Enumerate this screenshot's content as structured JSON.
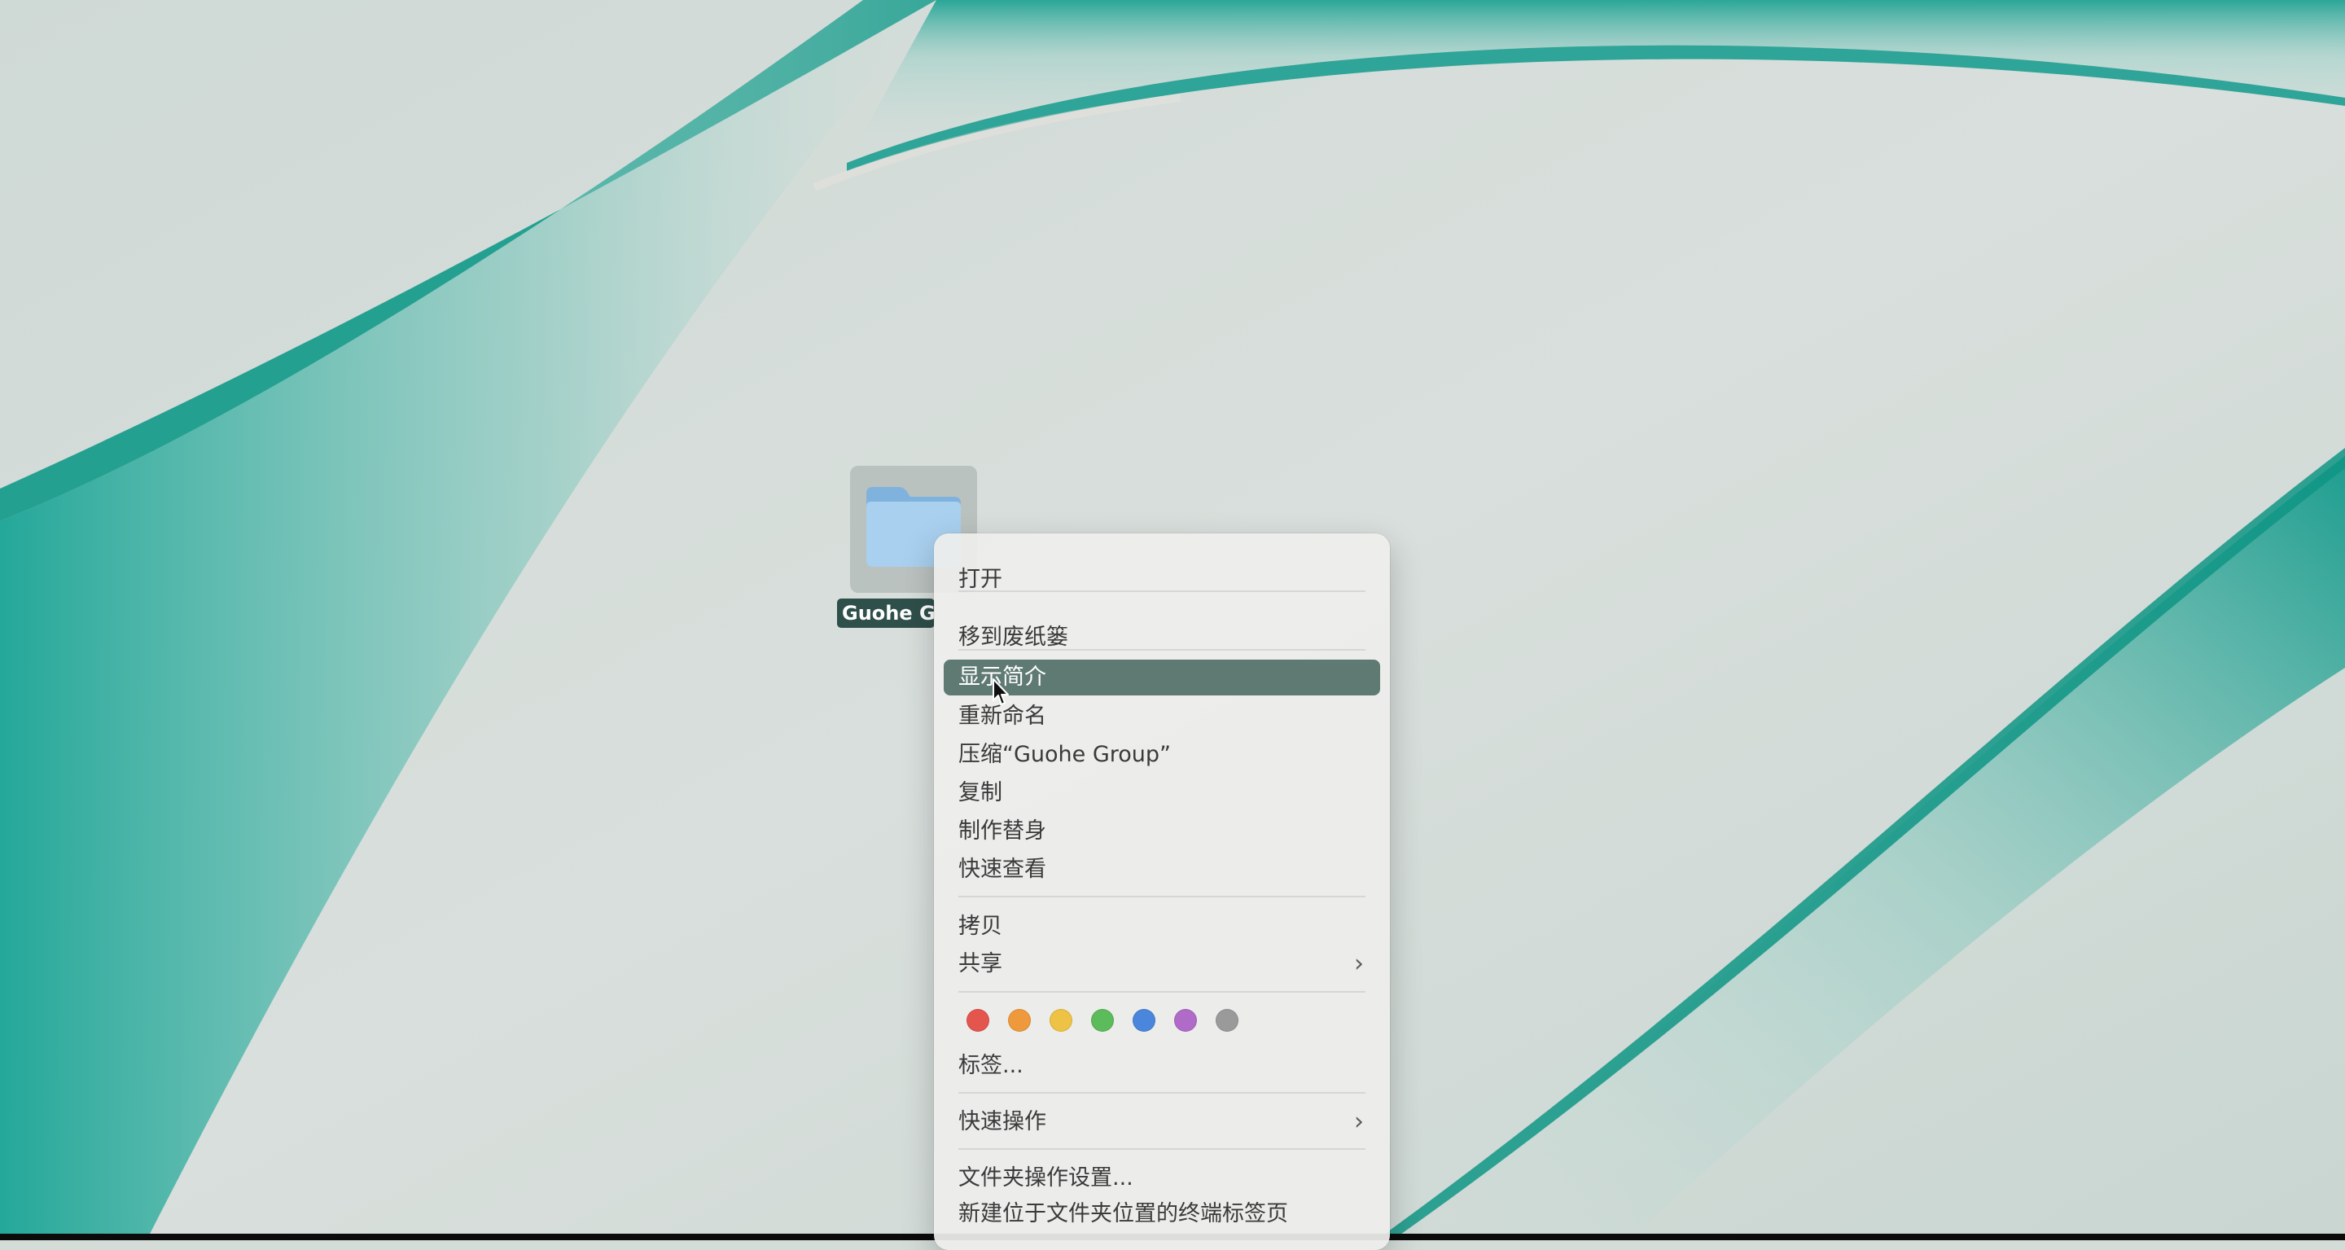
{
  "desktop": {
    "folder": {
      "name_visible": "Guohe G",
      "icon": "folder-icon"
    }
  },
  "context_menu": {
    "items": [
      {
        "label": "打开",
        "has_submenu": false
      },
      {
        "label": "移到废纸篓",
        "has_submenu": false
      },
      {
        "label": "显示简介",
        "has_submenu": false,
        "highlighted": true
      },
      {
        "label": "重新命名",
        "has_submenu": false
      },
      {
        "label": "压缩“Guohe Group”",
        "has_submenu": false
      },
      {
        "label": "复制",
        "has_submenu": false
      },
      {
        "label": "制作替身",
        "has_submenu": false
      },
      {
        "label": "快速查看",
        "has_submenu": false
      },
      {
        "label": "拷贝",
        "has_submenu": false
      },
      {
        "label": "共享",
        "has_submenu": true
      },
      {
        "label": "标签...",
        "has_submenu": false
      },
      {
        "label": "快速操作",
        "has_submenu": true
      },
      {
        "label": "文件夹操作设置...",
        "has_submenu": false
      },
      {
        "label": "新建位于文件夹位置的终端标签页",
        "has_submenu": false
      }
    ],
    "submenu_icon": "chevron-right-icon",
    "tag_colors": [
      {
        "name": "red",
        "hex": "#e4554e"
      },
      {
        "name": "orange",
        "hex": "#ee9a3c"
      },
      {
        "name": "yellow",
        "hex": "#eec244"
      },
      {
        "name": "green",
        "hex": "#5cbb5a"
      },
      {
        "name": "blue",
        "hex": "#4a86dc"
      },
      {
        "name": "purple",
        "hex": "#b06ac8"
      },
      {
        "name": "gray",
        "hex": "#9a9a9a"
      }
    ],
    "highlight_color": "#5f7a72"
  },
  "cursor": {
    "icon": "arrow-cursor-icon"
  }
}
